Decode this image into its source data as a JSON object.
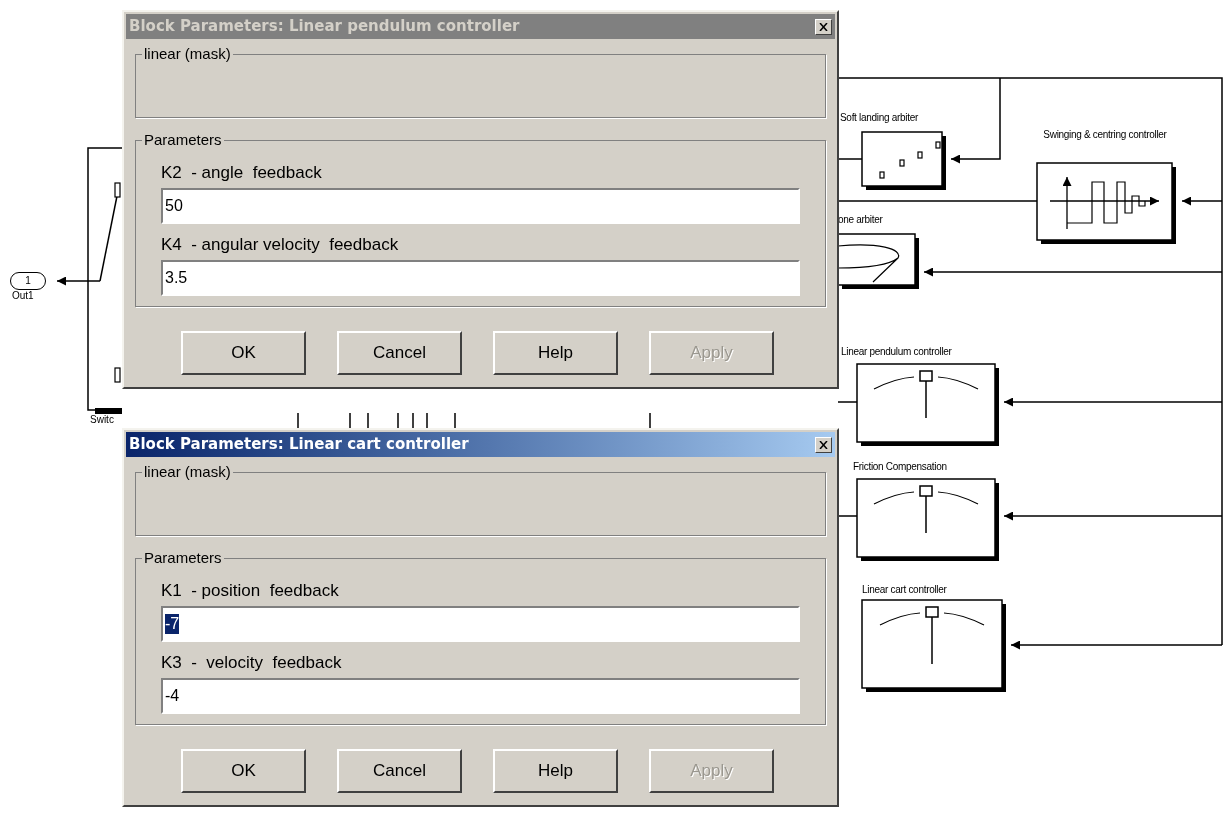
{
  "diagram": {
    "outport": {
      "number": "1",
      "label": "Out1"
    },
    "switch_label": "Switc",
    "blocks": [
      {
        "label": "Soft landing arbiter",
        "kind": "scatter"
      },
      {
        "label": "Swinging & centring controller",
        "kind": "pulse"
      },
      {
        "label": "one arbiter",
        "kind": "cone"
      },
      {
        "label": "Linear pendulum controller",
        "kind": "gauge"
      },
      {
        "label": "Friction Compensation",
        "kind": "gauge"
      },
      {
        "label": "Linear cart controller",
        "kind": "gauge"
      }
    ]
  },
  "dialogs": [
    {
      "title": "Block Parameters: Linear pendulum controller",
      "active": false,
      "mask_group": "linear (mask)",
      "params_group": "Parameters",
      "params": [
        {
          "label": "K2  - angle  feedback",
          "value": "50",
          "selected": false
        },
        {
          "label": "K4  - angular velocity  feedback",
          "value": "3.5",
          "selected": false
        }
      ],
      "buttons": [
        {
          "label": "OK",
          "disabled": false
        },
        {
          "label": "Cancel",
          "disabled": false
        },
        {
          "label": "Help",
          "disabled": false
        },
        {
          "label": "Apply",
          "disabled": true
        }
      ]
    },
    {
      "title": "Block Parameters: Linear cart controller",
      "active": true,
      "mask_group": "linear (mask)",
      "params_group": "Parameters",
      "params": [
        {
          "label": "K1  - position  feedback",
          "value": "-7",
          "selected": true
        },
        {
          "label": "K3  -  velocity  feedback",
          "value": "-4",
          "selected": false
        }
      ],
      "buttons": [
        {
          "label": "OK",
          "disabled": false
        },
        {
          "label": "Cancel",
          "disabled": false
        },
        {
          "label": "Help",
          "disabled": false
        },
        {
          "label": "Apply",
          "disabled": true
        }
      ]
    }
  ]
}
